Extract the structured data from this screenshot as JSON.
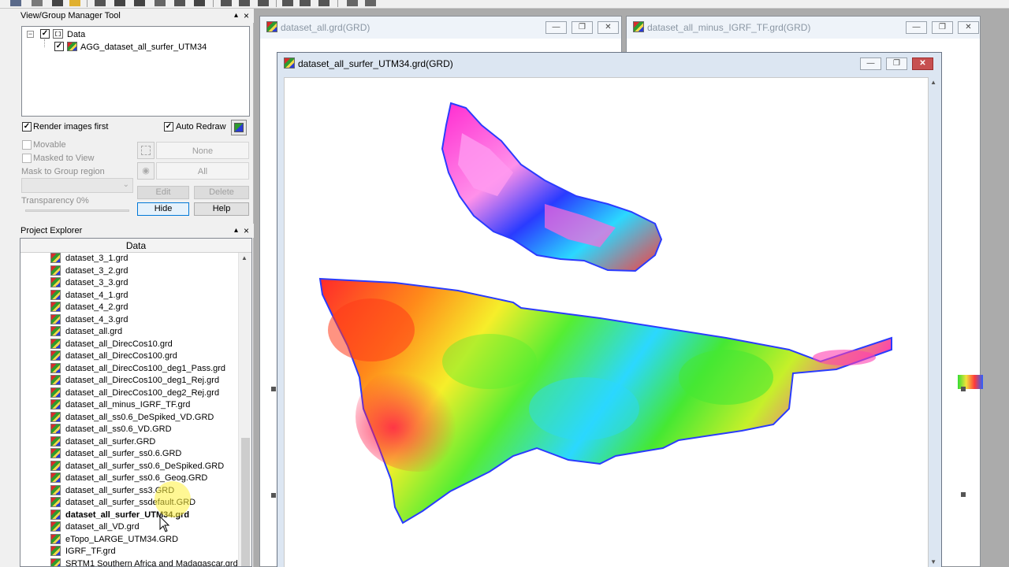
{
  "view_group_manager": {
    "title": "View/Group Manager Tool",
    "pin": "▴",
    "close": "×",
    "tree": {
      "root_label": "Data",
      "child_label": "AGG_dataset_all_surfer_UTM34",
      "expander": "⊟"
    },
    "render_images_first": "Render images first",
    "auto_redraw": "Auto Redraw",
    "movable": "Movable",
    "masked_to_view": "Masked to View",
    "mask_to_group_region": "Mask to Group region",
    "transparency": "Transparency 0%",
    "none_field": "None",
    "all_field": "All",
    "edit_button": "Edit",
    "delete_button": "Delete",
    "hide_button": "Hide",
    "help_button": "Help",
    "check_mark": "✓"
  },
  "project_explorer": {
    "title": "Project Explorer",
    "pin": "▴",
    "close": "×",
    "column_header": "Data",
    "scroll_up": "▲",
    "files": [
      {
        "name": "dataset_3_1.grd"
      },
      {
        "name": "dataset_3_2.grd"
      },
      {
        "name": "dataset_3_3.grd"
      },
      {
        "name": "dataset_4_1.grd"
      },
      {
        "name": "dataset_4_2.grd"
      },
      {
        "name": "dataset_4_3.grd"
      },
      {
        "name": "dataset_all.grd"
      },
      {
        "name": "dataset_all_DirecCos10.grd"
      },
      {
        "name": "dataset_all_DirecCos100.grd"
      },
      {
        "name": "dataset_all_DirecCos100_deg1_Pass.grd"
      },
      {
        "name": "dataset_all_DirecCos100_deg1_Rej.grd"
      },
      {
        "name": "dataset_all_DirecCos100_deg2_Rej.grd"
      },
      {
        "name": "dataset_all_minus_IGRF_TF.grd"
      },
      {
        "name": "dataset_all_ss0.6_DeSpiked_VD.GRD"
      },
      {
        "name": "dataset_all_ss0.6_VD.GRD"
      },
      {
        "name": "dataset_all_surfer.GRD"
      },
      {
        "name": "dataset_all_surfer_ss0.6.GRD"
      },
      {
        "name": "dataset_all_surfer_ss0.6_DeSpiked.GRD"
      },
      {
        "name": "dataset_all_surfer_ss0.6_Geog.GRD"
      },
      {
        "name": "dataset_all_surfer_ss3.GRD"
      },
      {
        "name": "dataset_all_surfer_ssdefault.GRD"
      },
      {
        "name": "dataset_all_surfer_UTM34.grd"
      },
      {
        "name": "dataset_all_VD.grd"
      },
      {
        "name": "eTopo_LARGE_UTM34.GRD"
      },
      {
        "name": "IGRF_TF.grd"
      },
      {
        "name": "SRTM1 Southern Africa and Madagascar.grd"
      }
    ]
  },
  "windows": {
    "win1_title": "dataset_all.grd(GRD)",
    "win2_title": "dataset_all_minus_IGRF_TF.grd(GRD)",
    "active_title": "dataset_all_surfer_UTM34.grd(GRD)",
    "minimize": "—",
    "restore": "❐",
    "close": "✕",
    "scroll_up": "▲",
    "scroll_down": "▼"
  },
  "colors": {
    "accent": "#0078d7",
    "map_red": "#ff1a1a",
    "map_green": "#33ee33",
    "map_blue": "#1a2aff",
    "map_magenta": "#ff2bd0"
  }
}
